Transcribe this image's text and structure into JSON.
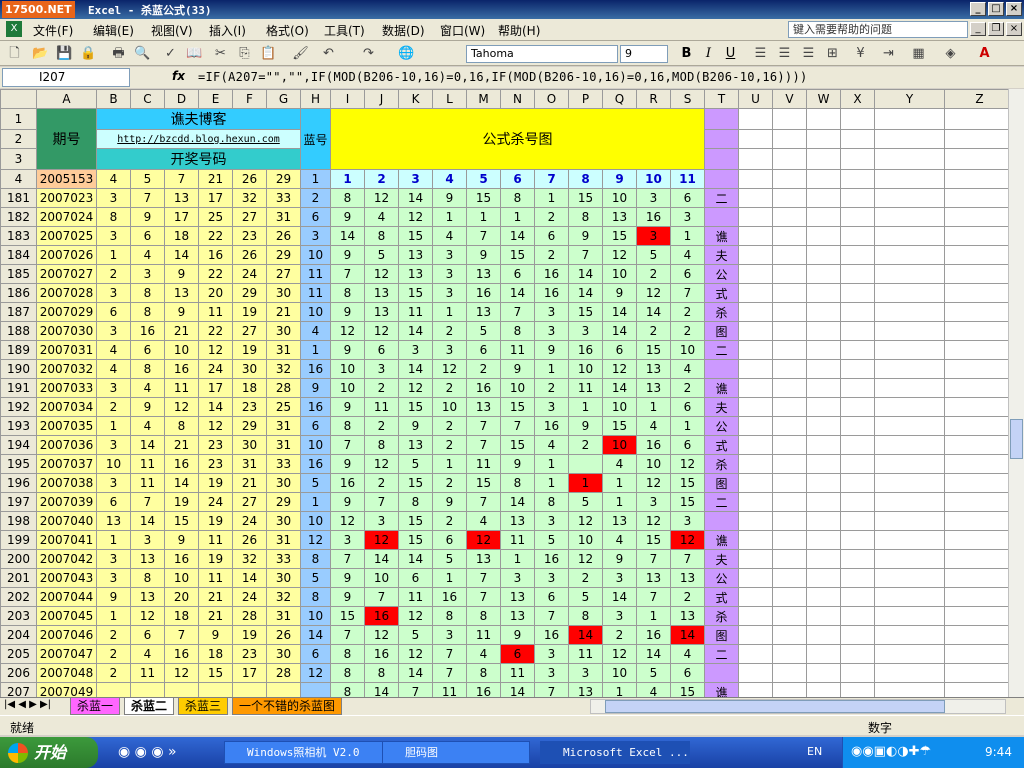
{
  "window": {
    "logo": "17500.NET",
    "title": "Excel - 杀蓝公式(33)"
  },
  "menu": [
    "文件(F)",
    "编辑(E)",
    "视图(V)",
    "插入(I)",
    "格式(O)",
    "工具(T)",
    "数据(D)",
    "窗口(W)",
    "帮助(H)"
  ],
  "help_placeholder": "键入需要帮助的问题",
  "toolbar": {
    "font": "Tahoma",
    "size": "9",
    "bold": "B",
    "italic": "I",
    "underline": "U"
  },
  "namebox": "I207",
  "fx": "fx",
  "formula": "=IF(A207=\"\",\"\",IF(MOD(B206-10,16)=0,16,IF(MOD(B206-10,16)=0,16,MOD(B206-10,16))))",
  "columns": [
    "A",
    "B",
    "C",
    "D",
    "E",
    "F",
    "G",
    "H",
    "I",
    "J",
    "K",
    "L",
    "M",
    "N",
    "O",
    "P",
    "Q",
    "R",
    "S",
    "T",
    "U",
    "V",
    "W",
    "X",
    "Y",
    "Z"
  ],
  "header": {
    "period": "期号",
    "blog": "谯夫博客",
    "url": "http://bzcdd.blog.hexun.com",
    "draw": "开奖号码",
    "blue": "蓝号",
    "chart": "公式杀号图",
    "row4": [
      "2005153",
      "4",
      "5",
      "7",
      "21",
      "26",
      "29",
      "1",
      "1",
      "2",
      "3",
      "4",
      "5",
      "6",
      "7",
      "8",
      "9",
      "10",
      "11"
    ]
  },
  "rows": [
    {
      "r": "181",
      "p": "2007023",
      "n": [
        "3",
        "7",
        "13",
        "17",
        "32",
        "33"
      ],
      "b": "2",
      "f": [
        "8",
        "12",
        "14",
        "9",
        "15",
        "8",
        "1",
        "15",
        "10",
        "3",
        "6"
      ],
      "t": "二"
    },
    {
      "r": "182",
      "p": "2007024",
      "n": [
        "8",
        "9",
        "17",
        "25",
        "27",
        "31"
      ],
      "b": "6",
      "f": [
        "9",
        "4",
        "12",
        "1",
        "1",
        "1",
        "2",
        "8",
        "13",
        "16",
        "3"
      ],
      "t": ""
    },
    {
      "r": "183",
      "p": "2007025",
      "n": [
        "3",
        "6",
        "18",
        "22",
        "23",
        "26"
      ],
      "b": "3",
      "f": [
        "14",
        "8",
        "15",
        "4",
        "7",
        "14",
        "6",
        "9",
        "15",
        "3",
        "1"
      ],
      "t": "谯"
    },
    {
      "r": "184",
      "p": "2007026",
      "n": [
        "1",
        "4",
        "14",
        "16",
        "26",
        "29"
      ],
      "b": "10",
      "f": [
        "9",
        "5",
        "13",
        "3",
        "9",
        "15",
        "2",
        "7",
        "12",
        "5",
        "4"
      ],
      "t": "夫"
    },
    {
      "r": "185",
      "p": "2007027",
      "n": [
        "2",
        "3",
        "9",
        "22",
        "24",
        "27"
      ],
      "b": "11",
      "f": [
        "7",
        "12",
        "13",
        "3",
        "13",
        "6",
        "16",
        "14",
        "10",
        "2",
        "6"
      ],
      "t": "公"
    },
    {
      "r": "186",
      "p": "2007028",
      "n": [
        "3",
        "8",
        "13",
        "20",
        "29",
        "30"
      ],
      "b": "11",
      "f": [
        "8",
        "13",
        "15",
        "3",
        "16",
        "14",
        "16",
        "14",
        "9",
        "12",
        "7"
      ],
      "t": "式"
    },
    {
      "r": "187",
      "p": "2007029",
      "n": [
        "6",
        "8",
        "9",
        "11",
        "19",
        "21"
      ],
      "b": "10",
      "f": [
        "9",
        "13",
        "11",
        "1",
        "13",
        "7",
        "3",
        "15",
        "14",
        "14",
        "2"
      ],
      "t": "杀"
    },
    {
      "r": "188",
      "p": "2007030",
      "n": [
        "3",
        "16",
        "21",
        "22",
        "27",
        "30"
      ],
      "b": "4",
      "f": [
        "12",
        "12",
        "14",
        "2",
        "5",
        "8",
        "3",
        "3",
        "14",
        "2",
        "2"
      ],
      "t": "图"
    },
    {
      "r": "189",
      "p": "2007031",
      "n": [
        "4",
        "6",
        "10",
        "12",
        "19",
        "31"
      ],
      "b": "1",
      "f": [
        "9",
        "6",
        "3",
        "3",
        "6",
        "11",
        "9",
        "16",
        "6",
        "15",
        "10"
      ],
      "t": "二"
    },
    {
      "r": "190",
      "p": "2007032",
      "n": [
        "4",
        "8",
        "16",
        "24",
        "30",
        "32"
      ],
      "b": "16",
      "f": [
        "10",
        "3",
        "14",
        "12",
        "2",
        "9",
        "1",
        "10",
        "12",
        "13",
        "4"
      ],
      "t": ""
    },
    {
      "r": "191",
      "p": "2007033",
      "n": [
        "3",
        "4",
        "11",
        "17",
        "18",
        "28"
      ],
      "b": "9",
      "f": [
        "10",
        "2",
        "12",
        "2",
        "16",
        "10",
        "2",
        "11",
        "14",
        "13",
        "2"
      ],
      "t": "谯"
    },
    {
      "r": "192",
      "p": "2007034",
      "n": [
        "2",
        "9",
        "12",
        "14",
        "23",
        "25"
      ],
      "b": "16",
      "f": [
        "9",
        "11",
        "15",
        "10",
        "13",
        "15",
        "3",
        "1",
        "10",
        "1",
        "6"
      ],
      "t": "夫"
    },
    {
      "r": "193",
      "p": "2007035",
      "n": [
        "1",
        "4",
        "8",
        "12",
        "29",
        "31"
      ],
      "b": "6",
      "f": [
        "8",
        "2",
        "9",
        "2",
        "7",
        "7",
        "16",
        "9",
        "15",
        "4",
        "1"
      ],
      "t": "公"
    },
    {
      "r": "194",
      "p": "2007036",
      "n": [
        "3",
        "14",
        "21",
        "23",
        "30",
        "31"
      ],
      "b": "10",
      "f": [
        "7",
        "8",
        "13",
        "2",
        "7",
        "15",
        "4",
        "2",
        "10",
        "16",
        "6"
      ],
      "t": "式"
    },
    {
      "r": "195",
      "p": "2007037",
      "n": [
        "10",
        "11",
        "16",
        "23",
        "31",
        "33"
      ],
      "b": "16",
      "f": [
        "9",
        "12",
        "5",
        "1",
        "11",
        "9",
        "1",
        "",
        "4",
        "10",
        "12"
      ],
      "t": "杀"
    },
    {
      "r": "196",
      "p": "2007038",
      "n": [
        "3",
        "11",
        "14",
        "19",
        "21",
        "30"
      ],
      "b": "5",
      "f": [
        "16",
        "2",
        "15",
        "2",
        "15",
        "8",
        "1",
        "1",
        "1",
        "12",
        "15"
      ],
      "t": "图"
    },
    {
      "r": "197",
      "p": "2007039",
      "n": [
        "6",
        "7",
        "19",
        "24",
        "27",
        "29"
      ],
      "b": "1",
      "f": [
        "9",
        "7",
        "8",
        "9",
        "7",
        "14",
        "8",
        "5",
        "1",
        "3",
        "15"
      ],
      "t": "二"
    },
    {
      "r": "198",
      "p": "2007040",
      "n": [
        "13",
        "14",
        "15",
        "19",
        "24",
        "30"
      ],
      "b": "10",
      "f": [
        "12",
        "3",
        "15",
        "2",
        "4",
        "13",
        "3",
        "12",
        "13",
        "12",
        "3"
      ],
      "t": ""
    },
    {
      "r": "199",
      "p": "2007041",
      "n": [
        "1",
        "3",
        "9",
        "11",
        "26",
        "31"
      ],
      "b": "12",
      "f": [
        "3",
        "12",
        "15",
        "6",
        "12",
        "11",
        "5",
        "10",
        "4",
        "15",
        "12"
      ],
      "t": "谯"
    },
    {
      "r": "200",
      "p": "2007042",
      "n": [
        "3",
        "13",
        "16",
        "19",
        "32",
        "33"
      ],
      "b": "8",
      "f": [
        "7",
        "14",
        "14",
        "5",
        "13",
        "1",
        "16",
        "12",
        "9",
        "7",
        "7"
      ],
      "t": "夫"
    },
    {
      "r": "201",
      "p": "2007043",
      "n": [
        "3",
        "8",
        "10",
        "11",
        "14",
        "30"
      ],
      "b": "5",
      "f": [
        "9",
        "10",
        "6",
        "1",
        "7",
        "3",
        "3",
        "2",
        "3",
        "13",
        "13"
      ],
      "t": "公"
    },
    {
      "r": "202",
      "p": "2007044",
      "n": [
        "9",
        "13",
        "20",
        "21",
        "24",
        "32"
      ],
      "b": "8",
      "f": [
        "9",
        "7",
        "11",
        "16",
        "7",
        "13",
        "6",
        "5",
        "14",
        "7",
        "2"
      ],
      "t": "式"
    },
    {
      "r": "203",
      "p": "2007045",
      "n": [
        "1",
        "12",
        "18",
        "21",
        "28",
        "31"
      ],
      "b": "10",
      "f": [
        "15",
        "16",
        "12",
        "8",
        "8",
        "13",
        "7",
        "8",
        "3",
        "1",
        "13"
      ],
      "t": "杀"
    },
    {
      "r": "204",
      "p": "2007046",
      "n": [
        "2",
        "6",
        "7",
        "9",
        "19",
        "26"
      ],
      "b": "14",
      "f": [
        "7",
        "12",
        "5",
        "3",
        "11",
        "9",
        "16",
        "14",
        "2",
        "16",
        "14"
      ],
      "t": "图"
    },
    {
      "r": "205",
      "p": "2007047",
      "n": [
        "2",
        "4",
        "16",
        "18",
        "23",
        "30"
      ],
      "b": "6",
      "f": [
        "8",
        "16",
        "12",
        "7",
        "4",
        "6",
        "3",
        "11",
        "12",
        "14",
        "4"
      ],
      "t": "二"
    },
    {
      "r": "206",
      "p": "2007048",
      "n": [
        "2",
        "11",
        "12",
        "15",
        "17",
        "28"
      ],
      "b": "12",
      "f": [
        "8",
        "8",
        "14",
        "7",
        "8",
        "11",
        "3",
        "3",
        "10",
        "5",
        "6"
      ],
      "t": ""
    },
    {
      "r": "207",
      "p": "2007049",
      "n": [
        "",
        "",
        "",
        "",
        "",
        ""
      ],
      "b": "",
      "f": [
        "8",
        "14",
        "7",
        "11",
        "16",
        "14",
        "7",
        "13",
        "1",
        "4",
        "15"
      ],
      "t": "谯"
    }
  ],
  "red_cells": [
    [
      2,
      9
    ],
    [
      13,
      8
    ],
    [
      15,
      7
    ],
    [
      18,
      1
    ],
    [
      18,
      4
    ],
    [
      18,
      10
    ],
    [
      22,
      1
    ],
    [
      23,
      7
    ],
    [
      23,
      10
    ],
    [
      24,
      5
    ]
  ],
  "sheet_tabs": [
    "杀蓝一",
    "杀蓝二",
    "杀蓝三",
    "一个不错的杀蓝图"
  ],
  "status": {
    "ready": "就绪",
    "mode": "数字"
  },
  "taskbar": {
    "start": "开始",
    "tasks": [
      "Windows照相机 V2.0",
      "胆码图",
      "Microsoft Excel ..."
    ],
    "lang": "EN",
    "time": "9:44"
  },
  "colors": {
    "yellow": "#ffffa0",
    "green": "#ccffcc",
    "red": "#ff0000",
    "purple": "#cc99ff",
    "blue": "#99ccff",
    "cyan": "#ccffff"
  }
}
